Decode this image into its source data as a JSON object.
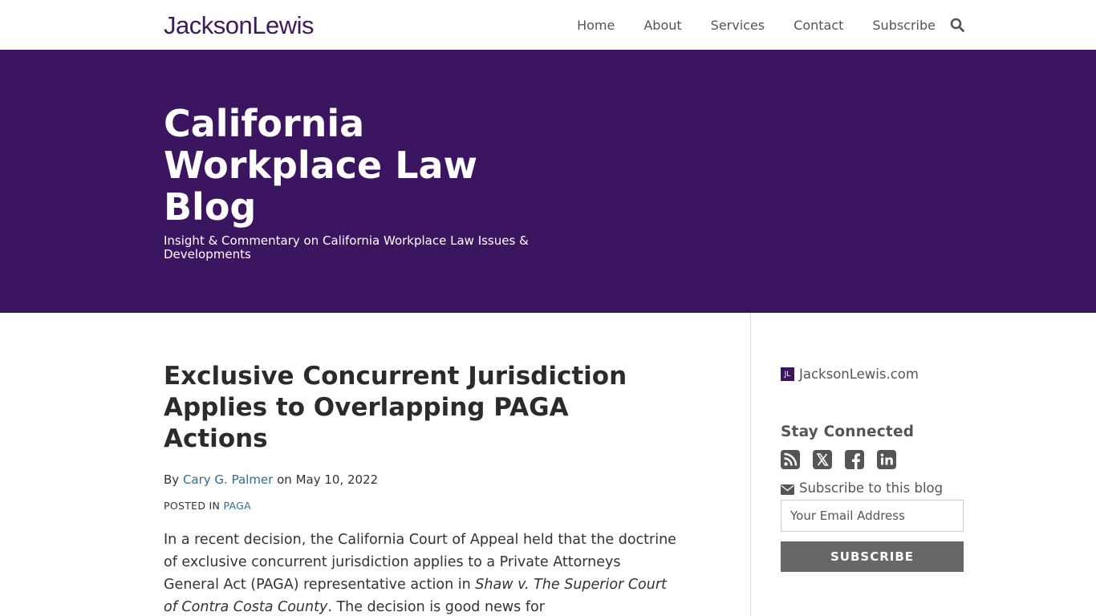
{
  "brand": {
    "logo_text": "JacksonLewis",
    "logo_color": "#3c1a5b"
  },
  "nav": {
    "items": [
      {
        "label": "Home"
      },
      {
        "label": "About"
      },
      {
        "label": "Services"
      },
      {
        "label": "Contact"
      },
      {
        "label": "Subscribe"
      }
    ],
    "search_icon": "search-icon"
  },
  "hero": {
    "title": "California Workplace Law Blog",
    "subtitle": "Insight & Commentary on California Workplace Law Issues & Developments",
    "background": "#3c1560"
  },
  "article": {
    "title": "Exclusive Concurrent Jurisdiction Applies to Overlapping PAGA Actions",
    "by_prefix": "By",
    "author": "Cary G. Palmer",
    "on_text": "on",
    "date": "May 10, 2022",
    "posted_in_label": "POSTED IN",
    "category": "PAGA",
    "body_part1": "In a recent decision, the California Court of Appeal held that the doctrine of exclusive concurrent jurisdiction applies to a Private Attorneys General Act (PAGA) representative action in ",
    "body_case": "Shaw v. The Superior Court of Contra Costa County",
    "body_part2": ". The decision is good news for"
  },
  "sidebar": {
    "site_badge": "JL",
    "site_link": "JacksonLewis.com",
    "stay_connected": "Stay Connected",
    "social_icons": [
      "rss-icon",
      "x-twitter-icon",
      "facebook-icon",
      "linkedin-icon"
    ],
    "subscribe_label": "Subscribe to this blog",
    "email_placeholder": "Your Email Address",
    "subscribe_button": "SUBSCRIBE"
  }
}
